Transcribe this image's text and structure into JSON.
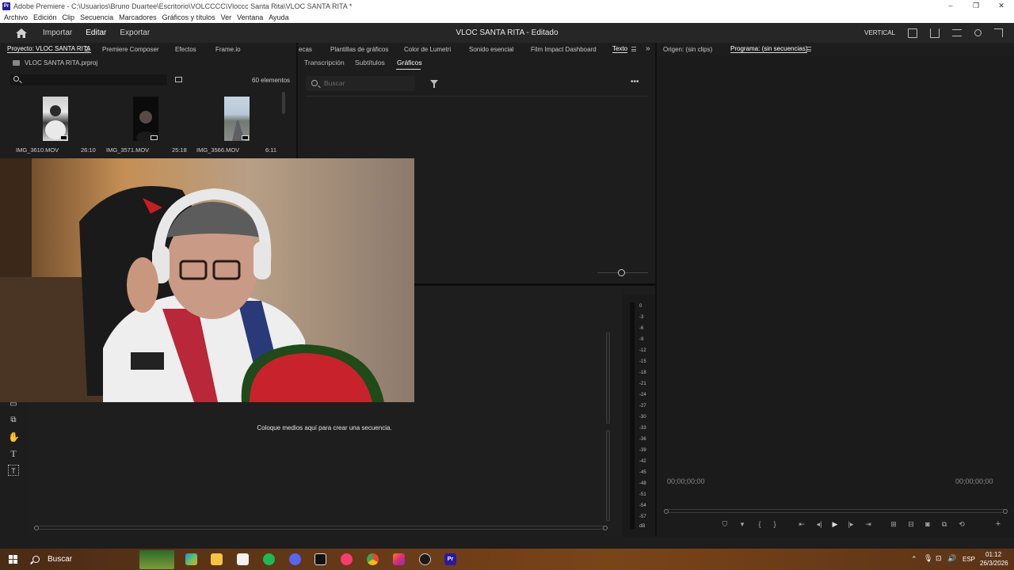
{
  "window": {
    "title": "Adobe Premiere - C:\\Usuarios\\Bruno Duartee\\Escritorio\\VOLCCCC\\Vloccc Santa Rita\\VLOC SANTA RITA *",
    "app_icon": "Pr",
    "controls": [
      "–",
      "❐",
      "✕"
    ]
  },
  "menu": [
    "Archivo",
    "Edición",
    "Clip",
    "Secuencia",
    "Marcadores",
    "Gráficos y títulos",
    "Ver",
    "Ventana",
    "Ayuda"
  ],
  "header": {
    "workspaces": [
      "Importar",
      "Editar",
      "Exportar"
    ],
    "active_workspace": "Editar",
    "doc_title": "VLOC SANTA RITA - Editado",
    "layout_label": "VERTICAL"
  },
  "project_panel": {
    "tabs": [
      "Proyecto: VLOC SANTA RITA",
      "Premiere Composer",
      "Efectos",
      "Frame.io"
    ],
    "file": "VLOC SANTA RITA.prproj",
    "item_count": "60 elementos",
    "search_placeholder": "",
    "clips": [
      {
        "name": "IMG_3610.MOV",
        "duration": "26:10"
      },
      {
        "name": "IMG_3571.MOV",
        "duration": "25:18"
      },
      {
        "name": "IMG_3566.MOV",
        "duration": "6:11"
      }
    ]
  },
  "graphics_panel": {
    "tabs": [
      "ecas",
      "Plantillas de gráficos",
      "Color de Lumetri",
      "Sonido esencial",
      "Film Impact Dashboard",
      "Texto"
    ],
    "active_tab": "Texto",
    "sub_tabs": [
      "Transcripción",
      "Subtítulos",
      "Gráficos"
    ],
    "active_sub_tab": "Gráficos",
    "search_placeholder": "Buscar"
  },
  "timeline": {
    "empty_message": "Coloque medios aquí para crear una secuencia."
  },
  "audio_meter": {
    "labels": [
      "0",
      "-3",
      "-6",
      "-9",
      "-12",
      "-15",
      "-18",
      "-21",
      "-24",
      "-27",
      "-30",
      "-33",
      "-36",
      "-39",
      "-42",
      "-45",
      "-48",
      "-51",
      "-54",
      "-57",
      "dB"
    ]
  },
  "monitors": {
    "source_tab": "Origen: (sin clips)",
    "program_tab": "Programa: (sin secuencias)",
    "timecode_left": "00;00;00;00",
    "timecode_right": "00;00;00;00"
  },
  "taskbar": {
    "search_label": "Buscar",
    "language": "ESP",
    "time": "01:12",
    "date": "26/3/2026"
  },
  "colors": {
    "accent_premiere": "#2a1aa0",
    "spotify": "#1db954",
    "discord": "#5865f2"
  }
}
